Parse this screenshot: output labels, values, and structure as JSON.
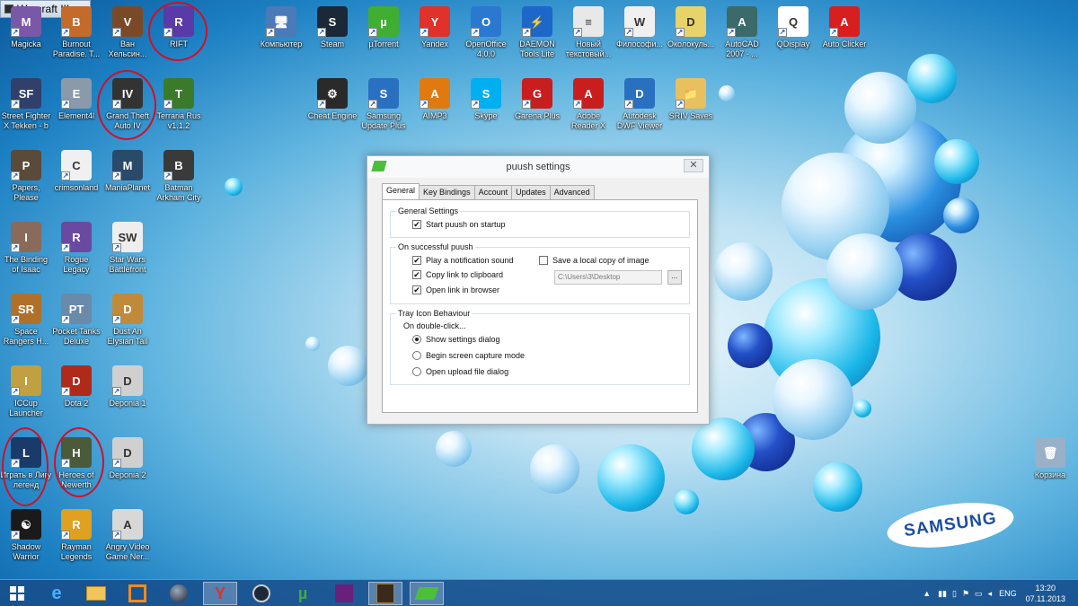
{
  "window_caption": "Warcraft III",
  "desktop_icons": [
    {
      "id": "magicka",
      "label": "Magicka",
      "color": "#7a58a8",
      "glyph": "M"
    },
    {
      "id": "burnout",
      "label": "Burnout Paradise. T...",
      "color": "#c46a2a",
      "glyph": "B"
    },
    {
      "id": "van-helsing",
      "label": "Ван Хельсин...",
      "color": "#7a4a28",
      "glyph": "V"
    },
    {
      "id": "rift",
      "label": "RIFT",
      "color": "#5a3aa8",
      "glyph": "R"
    },
    {
      "id": "computer",
      "label": "Компьютер",
      "color": "#4a7ab8",
      "glyph": "🖥"
    },
    {
      "id": "steam",
      "label": "Steam",
      "color": "#1b2838",
      "glyph": "S"
    },
    {
      "id": "utorrent",
      "label": "µTorrent",
      "color": "#3fae33",
      "glyph": "µ"
    },
    {
      "id": "yandex",
      "label": "Yandex",
      "color": "#e0312a",
      "glyph": "Y"
    },
    {
      "id": "openoffice",
      "label": "OpenOffice 4.0.0",
      "color": "#2a78d0",
      "glyph": "O"
    },
    {
      "id": "daemon",
      "label": "DAEMON Tools Lite",
      "color": "#1c67c8",
      "glyph": "⚡"
    },
    {
      "id": "new-text",
      "label": "Новый текстовый...",
      "color": "#e8e8e8",
      "glyph": "≡"
    },
    {
      "id": "philosophy",
      "label": "Философи...",
      "color": "#f0f0f0",
      "glyph": "W"
    },
    {
      "id": "okolokul",
      "label": "Околокуль...",
      "color": "#e8d26a",
      "glyph": "D"
    },
    {
      "id": "autocad",
      "label": "AutoCAD 2007 - ...",
      "color": "#3a6a6a",
      "glyph": "A"
    },
    {
      "id": "qdisplay",
      "label": "QDisplay",
      "color": "#ffffff",
      "glyph": "Q"
    },
    {
      "id": "autoclicker",
      "label": "Auto Clicker",
      "color": "#d81e1e",
      "glyph": "A"
    },
    {
      "id": "sf-tekken",
      "label": "Street Fighter X Tekken - b",
      "color": "#30406a",
      "glyph": "SF"
    },
    {
      "id": "element4l",
      "label": "Element4l",
      "color": "#8a9aaa",
      "glyph": "E"
    },
    {
      "id": "gta4",
      "label": "Grand Theft Auto IV",
      "color": "#333333",
      "glyph": "IV"
    },
    {
      "id": "terraria",
      "label": "Terraria Rus v1.1.2",
      "color": "#3a7a2a",
      "glyph": "T"
    },
    {
      "id": "cheat-engine",
      "label": "Cheat Engine",
      "color": "#2a2a2a",
      "glyph": "⚙"
    },
    {
      "id": "samsung-up",
      "label": "Samsung Update Plus",
      "color": "#2a70c0",
      "glyph": "S"
    },
    {
      "id": "aimp",
      "label": "AIMP3",
      "color": "#e07a10",
      "glyph": "A"
    },
    {
      "id": "skype",
      "label": "Skype",
      "color": "#00aff0",
      "glyph": "S"
    },
    {
      "id": "garena",
      "label": "Garena Plus",
      "color": "#c81e1e",
      "glyph": "G"
    },
    {
      "id": "adobe",
      "label": "Adobe Reader X",
      "color": "#c81e1e",
      "glyph": "A"
    },
    {
      "id": "dwf",
      "label": "Autodesk DWF Viewer",
      "color": "#2a70c0",
      "glyph": "D"
    },
    {
      "id": "sriv",
      "label": "SRIV Saves",
      "color": "#e8c060",
      "glyph": "📁"
    },
    {
      "id": "papers",
      "label": "Papers, Please",
      "color": "#5a4a3a",
      "glyph": "P"
    },
    {
      "id": "crimsonland",
      "label": "crimsonland",
      "color": "#f0f0f0",
      "glyph": "C"
    },
    {
      "id": "maniaplanet",
      "label": "ManiaPlanet",
      "color": "#2a4a6a",
      "glyph": "M"
    },
    {
      "id": "batman",
      "label": "Batman Arkham City",
      "color": "#3a3a3a",
      "glyph": "B"
    },
    {
      "id": "isaac",
      "label": "The Binding of Isaac",
      "color": "#8a6a5a",
      "glyph": "I"
    },
    {
      "id": "rogue",
      "label": "Rogue Legacy",
      "color": "#6a4aa0",
      "glyph": "R"
    },
    {
      "id": "swbf",
      "label": "Star Wars Battlefront",
      "color": "#eeeeee",
      "glyph": "SW"
    },
    {
      "id": "space-rangers",
      "label": "Space Rangers H...",
      "color": "#b0702a",
      "glyph": "SR"
    },
    {
      "id": "pocket-tanks",
      "label": "Pocket Tanks Deluxe",
      "color": "#6a8aaa",
      "glyph": "PT"
    },
    {
      "id": "dust",
      "label": "Dust An Elysian Tail",
      "color": "#c08a3a",
      "glyph": "D"
    },
    {
      "id": "iccup",
      "label": "ICCup Launcher",
      "color": "#c0a040",
      "glyph": "I"
    },
    {
      "id": "dota2",
      "label": "Dota 2",
      "color": "#b02a1a",
      "glyph": "D"
    },
    {
      "id": "deponia1",
      "label": "Deponia 1",
      "color": "#d0d0d0",
      "glyph": "D"
    },
    {
      "id": "lol",
      "label": "Играть в Лигу легенд",
      "color": "#1a3a6a",
      "glyph": "L"
    },
    {
      "id": "hon",
      "label": "Heroes of Newerth",
      "color": "#4a5a3a",
      "glyph": "H"
    },
    {
      "id": "deponia2",
      "label": "Deponia 2",
      "color": "#d0d0d0",
      "glyph": "D"
    },
    {
      "id": "shadow-warrior",
      "label": "Shadow Warrior",
      "color": "#1a1a1a",
      "glyph": "☯"
    },
    {
      "id": "rayman",
      "label": "Rayman Legends",
      "color": "#e0a020",
      "glyph": "R"
    },
    {
      "id": "avgn",
      "label": "Angry Video Game Ner...",
      "color": "#d8d8d8",
      "glyph": "A"
    },
    {
      "id": "recycle-bin",
      "label": "Корзина",
      "color": "#9ab0c8",
      "glyph": "🗑"
    }
  ],
  "dialog": {
    "title": "puush settings",
    "close": "✕",
    "tabs": [
      "General",
      "Key Bindings",
      "Account",
      "Updates",
      "Advanced"
    ],
    "general_settings": {
      "label": "General Settings",
      "start_on_startup": {
        "label": "Start puush on startup",
        "checked": true
      }
    },
    "on_push": {
      "label": "On successful puush",
      "play_sound": {
        "label": "Play a notification sound",
        "checked": true
      },
      "copy_link": {
        "label": "Copy link to clipboard",
        "checked": true
      },
      "open_link": {
        "label": "Open link in browser",
        "checked": true
      },
      "save_local": {
        "label": "Save a local copy of image",
        "checked": false
      },
      "path_value": "C:\\Users\\3\\Desktop",
      "browse_label": "..."
    },
    "tray": {
      "label": "Tray Icon Behaviour",
      "sub_label": "On double-click...",
      "options": [
        "Show settings dialog",
        "Begin screen capture mode",
        "Open upload file dialog"
      ],
      "selected": 0
    }
  },
  "brand": "SAMSUNG",
  "taskbar": {
    "apps": [
      "start",
      "ie",
      "explorer",
      "app-orange",
      "app-globe",
      "yandex",
      "steam",
      "utorrent",
      "visual-studio",
      "warcraft",
      "puush"
    ],
    "language": "ENG",
    "time": "13:20",
    "date": "07.11.2013"
  }
}
